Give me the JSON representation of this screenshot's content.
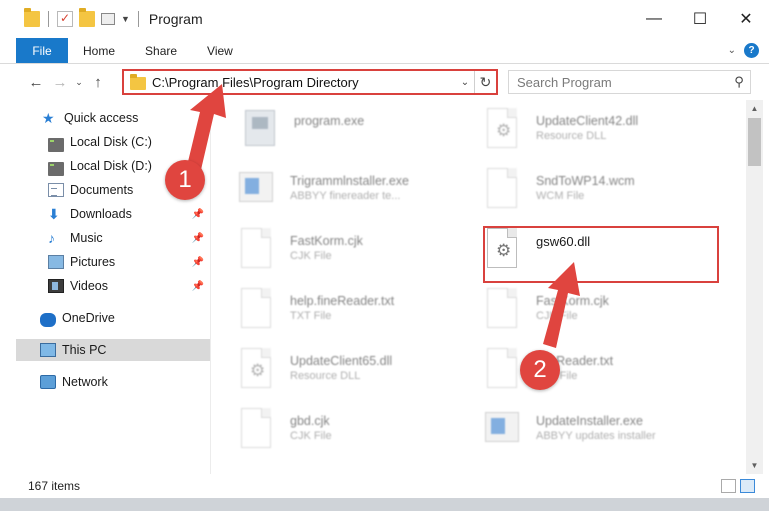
{
  "window": {
    "title": "Program",
    "minimize_icon": "minimize-icon",
    "maximize_icon": "maximize-icon",
    "close_icon": "close-icon"
  },
  "ribbon": {
    "tabs": [
      {
        "label": "File",
        "active": true
      },
      {
        "label": "Home"
      },
      {
        "label": "Share"
      },
      {
        "label": "View"
      }
    ]
  },
  "address": {
    "path": "C:\\Program Files\\Program Directory"
  },
  "search": {
    "placeholder": "Search Program"
  },
  "sidebar": {
    "items": [
      {
        "label": "Quick access",
        "icon": "star-icon"
      },
      {
        "label": "Local Disk (C:)",
        "icon": "disk-icon",
        "pinned": true
      },
      {
        "label": "Local Disk (D:)",
        "icon": "disk-icon",
        "pinned": true
      },
      {
        "label": "Documents",
        "icon": "documents-icon",
        "pinned": true
      },
      {
        "label": "Downloads",
        "icon": "downloads-icon",
        "pinned": true
      },
      {
        "label": "Music",
        "icon": "music-icon",
        "pinned": true
      },
      {
        "label": "Pictures",
        "icon": "pictures-icon",
        "pinned": true
      },
      {
        "label": "Videos",
        "icon": "videos-icon",
        "pinned": true
      },
      {
        "label": "OneDrive",
        "icon": "onedrive-icon"
      },
      {
        "label": "This PC",
        "icon": "pc-icon",
        "selected": true
      },
      {
        "label": "Network",
        "icon": "network-icon"
      }
    ]
  },
  "files": [
    {
      "name": "program.exe",
      "type": "",
      "icon": "exe-icon"
    },
    {
      "name": "UpdateClient42.dll",
      "type": "Resource DLL",
      "icon": "dll-icon"
    },
    {
      "name": "Trigrammlnstaller.exe",
      "type": "ABBYY finereader te...",
      "icon": "app-icon"
    },
    {
      "name": "SndToWP14.wcm",
      "type": "WCM File",
      "icon": "file-icon"
    },
    {
      "name": "FastKorm.cjk",
      "type": "CJK File",
      "icon": "file-icon"
    },
    {
      "name": "gsw60.dll",
      "type": "",
      "icon": "dll-icon"
    },
    {
      "name": "help.fineReader.txt",
      "type": "TXT File",
      "icon": "file-icon"
    },
    {
      "name": "FastKorm.cjk",
      "type": "CJK File",
      "icon": "file-icon"
    },
    {
      "name": "UpdateClient65.dll",
      "type": "Resource DLL",
      "icon": "dll-icon"
    },
    {
      "name": "fineReader.txt",
      "type": "TXT File",
      "icon": "file-icon"
    },
    {
      "name": "gbd.cjk",
      "type": "CJK File",
      "icon": "file-icon"
    },
    {
      "name": "UpdateInstaller.exe",
      "type": "ABBYY updates installer",
      "icon": "app-icon"
    }
  ],
  "status": {
    "items_count": "167 items"
  },
  "annotations": {
    "step1": "1",
    "step2": "2",
    "color": "#e0453f"
  },
  "colors": {
    "accent": "#1979ca",
    "highlight": "#d9413d"
  }
}
